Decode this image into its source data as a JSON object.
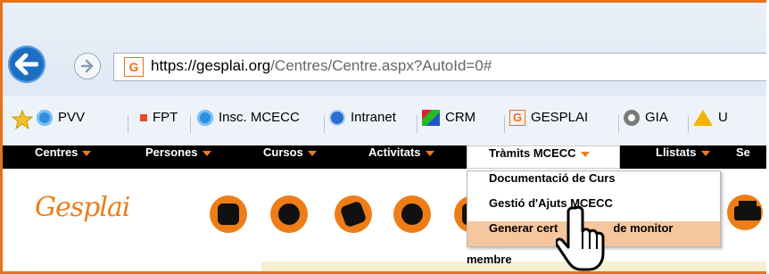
{
  "browser": {
    "url_domain": "https://gesplai.org",
    "url_path": "/Centres/Centre.aspx?AutoId=0#",
    "favicon_letter": "G"
  },
  "bookmarks": [
    {
      "label": "PVV",
      "icon": "ie-icon"
    },
    {
      "label": "FPT",
      "icon": "orange-square-icon"
    },
    {
      "label": "Insc. MCECC",
      "icon": "ie-icon"
    },
    {
      "label": "Intranet",
      "icon": "globe-icon"
    },
    {
      "label": "CRM",
      "icon": "chart-icon"
    },
    {
      "label": "GESPLAI",
      "icon": "gesplai-icon"
    },
    {
      "label": "GIA",
      "icon": "gear-icon"
    },
    {
      "label": "U",
      "icon": "drive-icon"
    }
  ],
  "nav": {
    "items": [
      "Centres",
      "Persones",
      "Cursos",
      "Activitats",
      "Tràmits MCECC",
      "Llistats",
      "Se"
    ]
  },
  "dropdown": {
    "items": [
      "Documentació de Curs",
      "Gestió d'Ajuts MCECC",
      "Generar cert",
      "de monitor"
    ],
    "below": "membre"
  },
  "logo": "Gesplai",
  "colors": {
    "accent": "#ee7d18",
    "nav_bg": "#000000",
    "highlight": "#f6c69e"
  }
}
